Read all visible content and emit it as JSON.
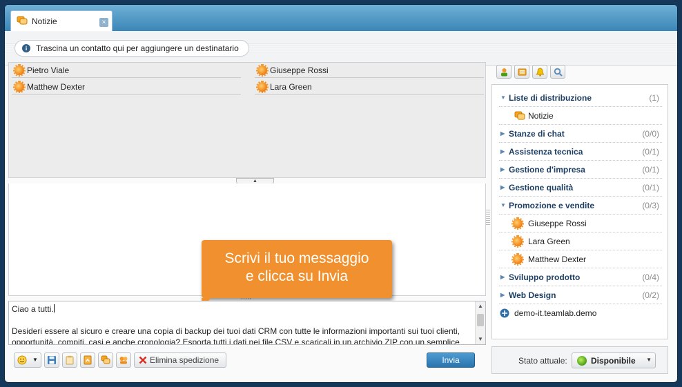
{
  "tab": {
    "label": "Notizie",
    "close": "×"
  },
  "hint": {
    "text": "Trascina un contatto qui per aggiungere un destinatario",
    "info_glyph": "i"
  },
  "recipients": [
    {
      "name": "Pietro Viale"
    },
    {
      "name": "Giuseppe Rossi"
    },
    {
      "name": "Matthew Dexter"
    },
    {
      "name": "Lara Green"
    }
  ],
  "collapse_glyph": "▲",
  "tooltip": {
    "line1": "Scrivi il tuo messaggio",
    "line2": "e clicca su Invia"
  },
  "composer": {
    "line1": "Ciao a tutti.",
    "line2": "",
    "line3": "Desideri essere al sicuro e creare una copia di backup dei tuoi dati CRM con tutte le informazioni importanti sui tuoi clienti,",
    "line4": "opportunità, compiti, casi e anche cronologia? Esporta tutti i dati nei file CSV e scaricali in un archivio ZIP con un semplice"
  },
  "toolbar": {
    "delete_label": "Elimina spedizione",
    "send_label": "Invia",
    "emoji_dropdown": "▼"
  },
  "sidebar": {
    "groups": [
      {
        "label": "Liste di distribuzione",
        "count": "(1)",
        "expanded": true,
        "items": [
          "Notizie"
        ]
      },
      {
        "label": "Stanze di chat",
        "count": "(0/0)",
        "expanded": false
      },
      {
        "label": "Assistenza tecnica",
        "count": "(0/1)",
        "expanded": false
      },
      {
        "label": "Gestione d'impresa",
        "count": "(0/1)",
        "expanded": false
      },
      {
        "label": "Gestione qualità",
        "count": "(0/1)",
        "expanded": false
      },
      {
        "label": "Promozione e vendite",
        "count": "(0/3)",
        "expanded": true,
        "items": [
          "Giuseppe Rossi",
          "Lara Green",
          "Matthew Dexter"
        ]
      },
      {
        "label": "Sviluppo prodotto",
        "count": "(0/4)",
        "expanded": false
      },
      {
        "label": "Web Design",
        "count": "(0/2)",
        "expanded": false
      }
    ],
    "server": "demo-it.teamlab.demo",
    "arrow_open": "▼",
    "arrow_closed": "▶"
  },
  "status": {
    "label": "Stato attuale:",
    "value": "Disponibile",
    "chevron": "▼"
  },
  "colors": {
    "accent": "#2a74ad",
    "tooltip": "#f0902e",
    "group_text": "#1e3f63",
    "presence_away": "#ef7d13",
    "presence_online": "#4c9d16"
  }
}
